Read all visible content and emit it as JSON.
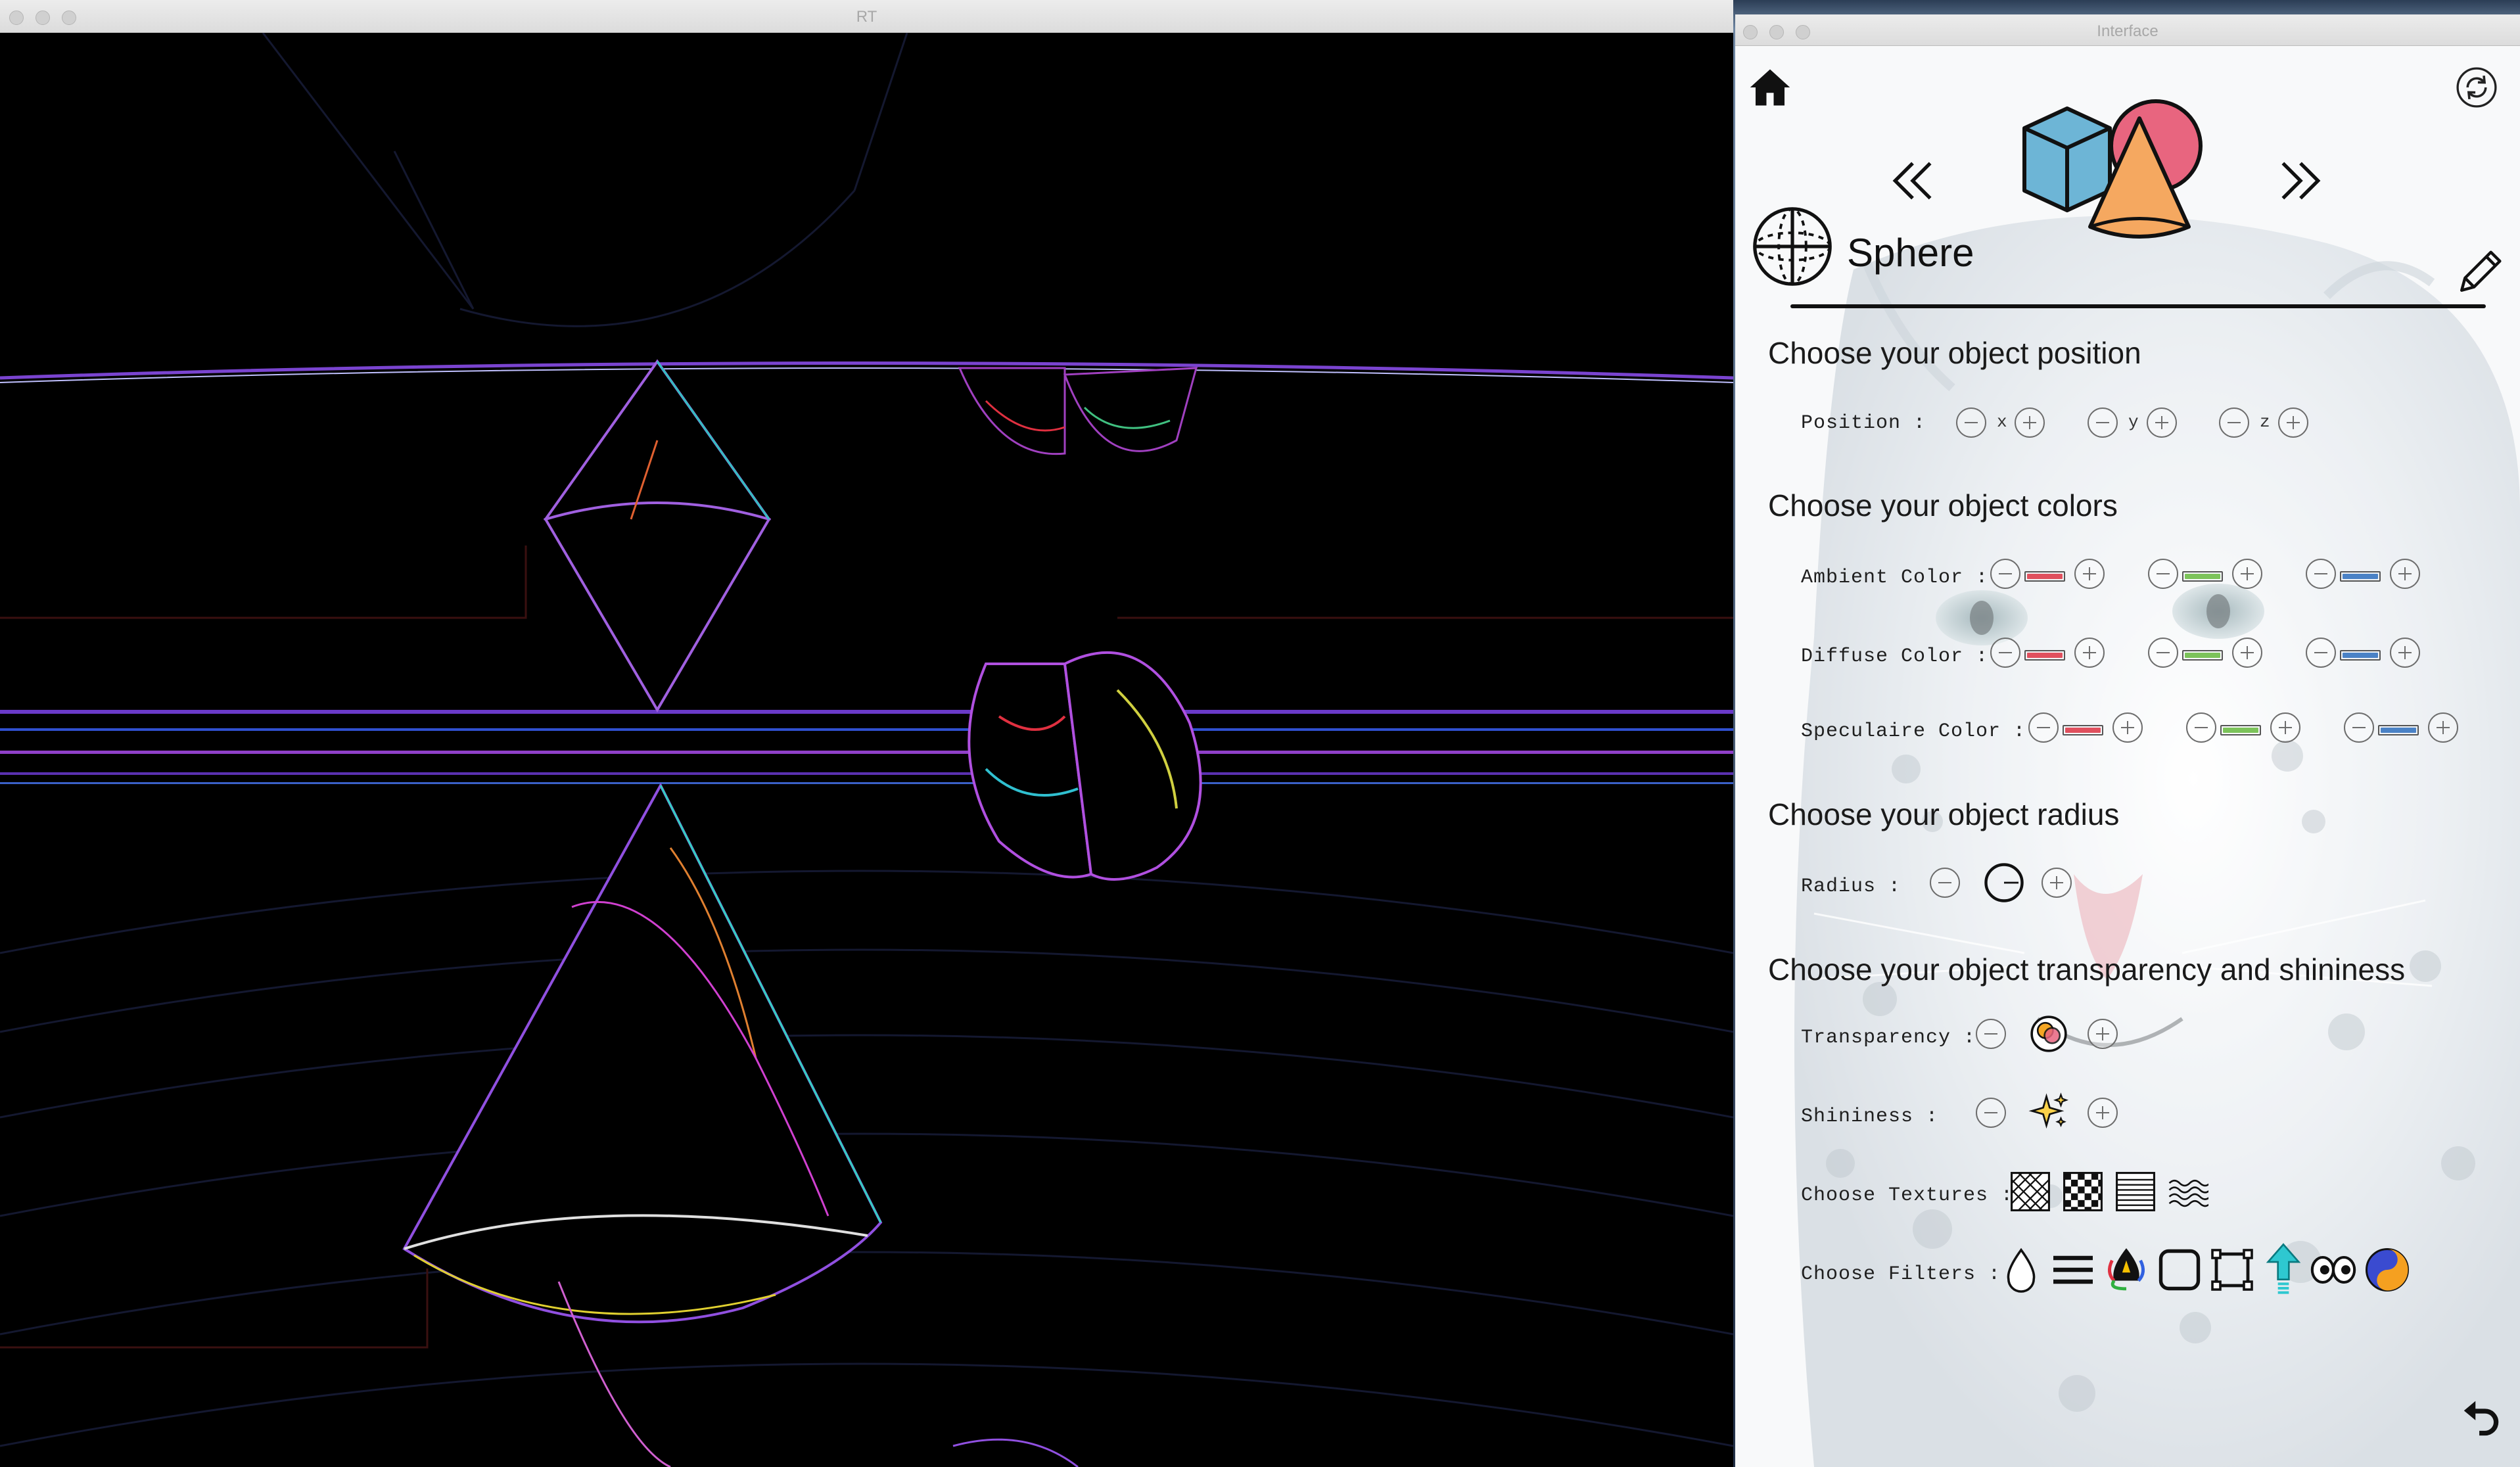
{
  "windows": {
    "render": {
      "title": "RT"
    },
    "interface": {
      "title": "Interface"
    }
  },
  "interface": {
    "object_name": "Sphere",
    "icons": {
      "home": "home-icon",
      "refresh": "refresh-icon",
      "previous": "double-chevron-left-icon",
      "next": "double-chevron-right-icon",
      "shapes": "cube-sphere-cone-icon",
      "sphere": "sphere-wireframe-icon",
      "edit": "pencil-icon",
      "undo": "undo-arrow-icon"
    },
    "sections": {
      "position": "Choose your object position",
      "colors": "Choose your object colors",
      "radius": "Choose your object radius",
      "transparency": "Choose your object transparency and shininess"
    },
    "position": {
      "label": "Position :",
      "axes": [
        "x",
        "y",
        "z"
      ]
    },
    "colors": {
      "ambient": "Ambient Color :",
      "diffuse": "Diffuse Color :",
      "speculaire": "Speculaire Color :",
      "channels": [
        "#e0505e",
        "#7cc35a",
        "#4a82c6"
      ]
    },
    "radius": {
      "label": "Radius :"
    },
    "transparency": {
      "label": "Transparency :"
    },
    "shininess": {
      "label": "Shininess :"
    },
    "textures": {
      "label": "Choose Textures :",
      "items": [
        "diagonal-weave-texture-icon",
        "checkerboard-texture-icon",
        "horizontal-lines-texture-icon",
        "wave-texture-icon"
      ]
    },
    "filters": {
      "label": "Choose Filters :",
      "items": [
        "drop-filter-icon",
        "lines-filter-icon",
        "rgb-filter-icon",
        "square-filter-icon",
        "crop-filter-icon",
        "arrow-up-filter-icon",
        "stereo-filter-icon",
        "yin-yang-filter-icon"
      ]
    }
  }
}
